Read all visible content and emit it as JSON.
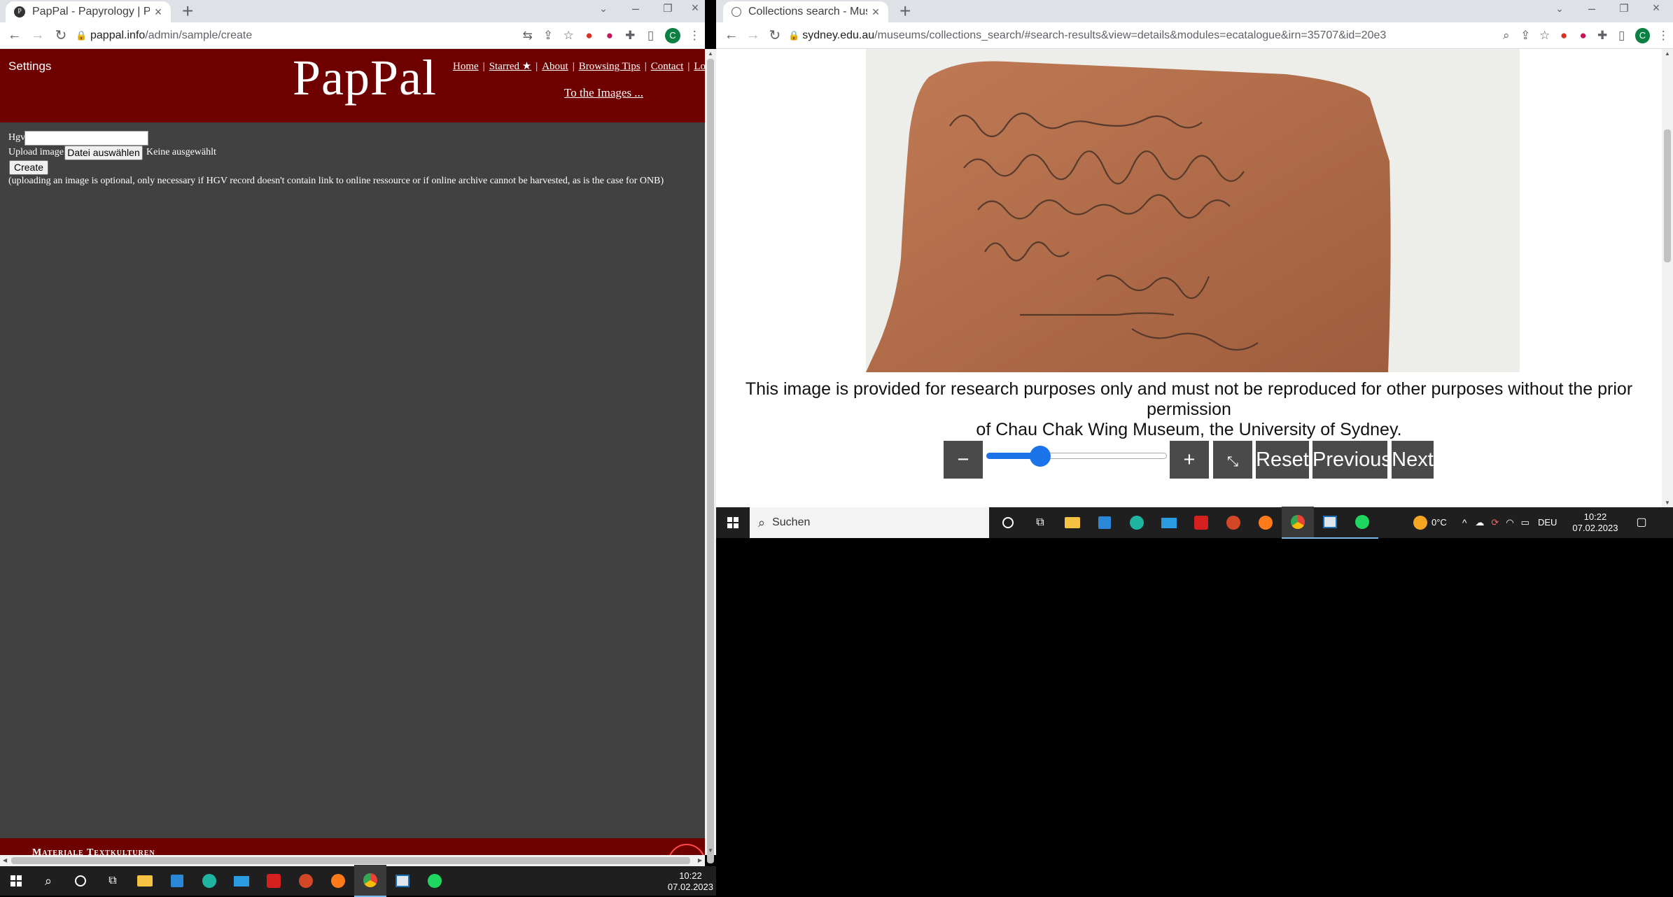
{
  "left_browser": {
    "tab_title": "PapPal - Papyrology | Paleographi",
    "url_host": "pappal.info",
    "url_path": "/admin/sample/create",
    "page": {
      "settings_label": "Settings",
      "logo": "PapPal",
      "nav": [
        "Home",
        "Starred ★",
        "About",
        "Browsing Tips",
        "Contact",
        "Logout"
      ],
      "images_link": "To the Images ...",
      "hgv_label": "Hgv",
      "upload_label": "Upload image",
      "file_button": "Datei auswählen",
      "file_status": "Keine ausgewählt",
      "create_button": "Create",
      "note": "(uploading an image is optional, only necessary if HGV record doesn't contain link to online ressource or if online archive cannot be harvested, as is the case for ONB)",
      "footer_text": "Materiale Textkulturen"
    }
  },
  "right_browser": {
    "tab_title": "Collections search - Museums - T",
    "url_host": "sydney.edu.au",
    "url_path": "/museums/collections_search/#search-results&view=details&modules=ecatalogue&irn=35707&id=20e3",
    "page": {
      "caption_line1": "This image is provided for research purposes only and must not be reproduced for other purposes without the prior permission",
      "caption_line2": "of Chau Chak Wing Museum, the University of Sydney.",
      "zoom_out": "−",
      "zoom_in": "+",
      "reset": "Reset",
      "previous": "Previous",
      "next": "Next",
      "zoom_level": 0.27
    },
    "taskbar": {
      "search_placeholder": "Suchen",
      "weather": "0°C",
      "lang": "DEU",
      "time": "10:22",
      "date": "07.02.2023"
    }
  },
  "main_taskbar": {
    "time": "10:22",
    "date": "07.02.2023"
  },
  "colors": {
    "pappal_red": "#6f0000",
    "pappal_body": "#414141",
    "slider_blue": "#1a73e8"
  }
}
